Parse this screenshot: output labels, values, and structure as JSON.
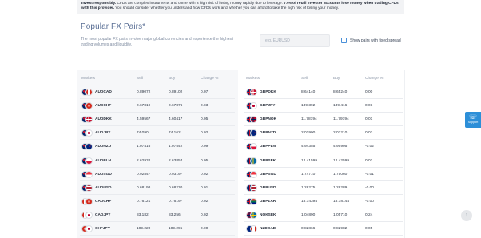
{
  "risk_warning": {
    "bold1": "Invest responsibly.",
    "text1": "CFDs are complex instruments and come with a high risk of losing money rapidly due to leverage.",
    "bold2": "77% of retail investor accounts lose money when trading CFDs with this provider.",
    "text2": "You should consider whether you understand how CFDs work and whether you can afford to take the high risk of losing your money."
  },
  "header": {
    "title": "Popular FX Pairs*",
    "subtitle": "The most popular FX pairs involve major global currencies and experience the highest trading volumes and liquidity."
  },
  "search": {
    "placeholder": "e.g. EURUSD",
    "value": ""
  },
  "fixed_spread": {
    "label": "Show pairs with fixed spread",
    "checked": false
  },
  "columns": {
    "markets": "Markets",
    "sell": "Sell",
    "buy": "Buy",
    "change": "Change %"
  },
  "left_table": [
    {
      "symbol": "AUDCAD",
      "sell": "0.89072",
      "buy": "0.89102",
      "change": "0.07",
      "flags": [
        "au",
        "ca"
      ]
    },
    {
      "symbol": "AUDCHF",
      "sell": "0.67819",
      "buy": "0.67876",
      "change": "0.03",
      "flags": [
        "au",
        "ch"
      ]
    },
    {
      "symbol": "AUDDKK",
      "sell": "4.59567",
      "buy": "4.60417",
      "change": "0.05",
      "flags": [
        "au",
        "dk"
      ]
    },
    {
      "symbol": "AUDJPY",
      "sell": "74.090",
      "buy": "74.162",
      "change": "0.02",
      "flags": [
        "au",
        "jp"
      ]
    },
    {
      "symbol": "AUDNZD",
      "sell": "1.07416",
      "buy": "1.07542",
      "change": "0.09",
      "flags": [
        "au",
        "nz"
      ]
    },
    {
      "symbol": "AUDPLN",
      "sell": "2.62932",
      "buy": "2.63854",
      "change": "0.05",
      "flags": [
        "au",
        "pl"
      ]
    },
    {
      "symbol": "AUDSGD",
      "sell": "0.92847",
      "buy": "0.93197",
      "change": "0.02",
      "flags": [
        "au",
        "sg"
      ]
    },
    {
      "symbol": "AUDUSD",
      "sell": "0.68198",
      "buy": "0.68230",
      "change": "0.01",
      "flags": [
        "au",
        "us"
      ]
    },
    {
      "symbol": "CADCHF",
      "sell": "0.76121",
      "buy": "0.76197",
      "change": "0.02",
      "flags": [
        "ca",
        "ch"
      ]
    },
    {
      "symbol": "CADJPY",
      "sell": "83.182",
      "buy": "83.256",
      "change": "0.02",
      "flags": [
        "ca",
        "jp"
      ]
    },
    {
      "symbol": "CHFJPY",
      "sell": "109.220",
      "buy": "109.295",
      "change": "0.00",
      "flags": [
        "ch",
        "jp"
      ]
    }
  ],
  "right_table": [
    {
      "symbol": "GBPDKK",
      "sell": "8.64140",
      "buy": "8.65240",
      "change": "0.00",
      "flags": [
        "gb",
        "dk"
      ]
    },
    {
      "symbol": "GBPJPY",
      "sell": "139.392",
      "buy": "139.416",
      "change": "0.01",
      "flags": [
        "gb",
        "jp"
      ]
    },
    {
      "symbol": "GBPNOK",
      "sell": "11.78794",
      "buy": "11.79794",
      "change": "0.01",
      "flags": [
        "gb",
        "no"
      ]
    },
    {
      "symbol": "GBPNZD",
      "sell": "2.01990",
      "buy": "2.02210",
      "change": "0.03",
      "flags": [
        "gb",
        "nz"
      ]
    },
    {
      "symbol": "GBPPLN",
      "sell": "4.94355",
      "buy": "4.95905",
      "change": "-0.02",
      "flags": [
        "gb",
        "pl"
      ]
    },
    {
      "symbol": "GBPSEK",
      "sell": "12.41599",
      "buy": "12.42599",
      "change": "0.02",
      "flags": [
        "gb",
        "se"
      ]
    },
    {
      "symbol": "GBPSGD",
      "sell": "1.74710",
      "buy": "1.75060",
      "change": "-0.01",
      "flags": [
        "gb",
        "sg"
      ]
    },
    {
      "symbol": "GBPUSD",
      "sell": "1.28275",
      "buy": "1.28289",
      "change": "-0.00",
      "flags": [
        "gb",
        "us"
      ]
    },
    {
      "symbol": "GBPZAR",
      "sell": "18.74394",
      "buy": "18.78144",
      "change": "-0.00",
      "flags": [
        "gb",
        "za"
      ]
    },
    {
      "symbol": "NOKSEK",
      "sell": "1.04890",
      "buy": "1.05710",
      "change": "0.24",
      "flags": [
        "no",
        "se"
      ]
    },
    {
      "symbol": "NZDCAD",
      "sell": "0.82866",
      "buy": "0.82982",
      "change": "0.05",
      "flags": [
        "nz",
        "ca"
      ]
    }
  ],
  "support": {
    "label": "Support",
    "icon": "headset-icon"
  },
  "scroll_top": {
    "icon": "arrow-up-icon"
  }
}
